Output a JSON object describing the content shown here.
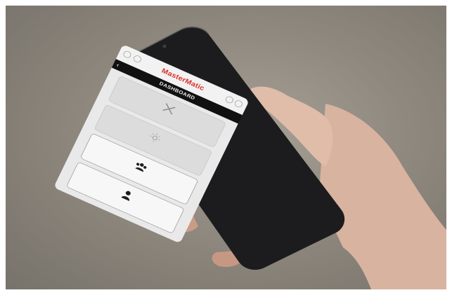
{
  "app": {
    "logo_text": "MasterMatic",
    "screen_title": "DASHBOARD",
    "brand_color": "#d9342b"
  },
  "dashboard": {
    "tiles": [
      {
        "label": "",
        "icon": "tools-icon",
        "state": "disabled"
      },
      {
        "label": "",
        "icon": "sun-icon",
        "state": "disabled"
      },
      {
        "label": "",
        "icon": "group-icon",
        "state": "enabled"
      },
      {
        "label": "",
        "icon": "person-icon",
        "state": "enabled"
      }
    ]
  }
}
